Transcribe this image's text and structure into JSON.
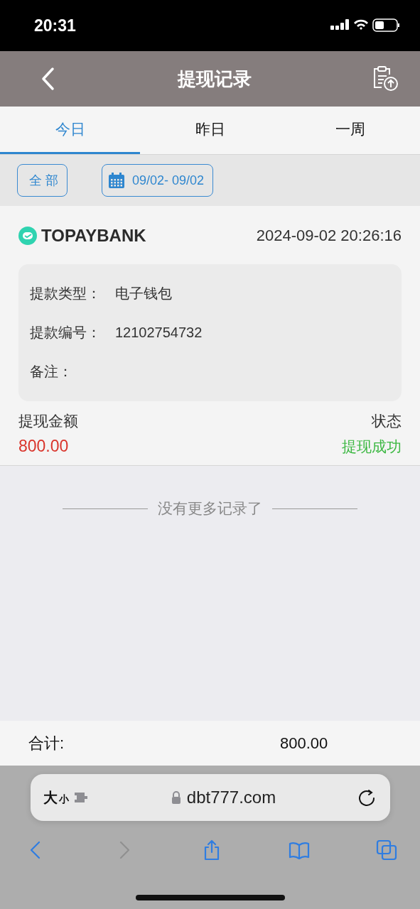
{
  "status_bar": {
    "time": "20:31"
  },
  "header": {
    "title": "提现记录"
  },
  "tabs": [
    {
      "label": "今日",
      "selected": true
    },
    {
      "label": "昨日",
      "selected": false
    },
    {
      "label": "一周",
      "selected": false
    }
  ],
  "filters": {
    "all_button": "全 部",
    "date_range": "09/02- 09/02"
  },
  "records": [
    {
      "bank": "TOPAYBANK",
      "time": "2024-09-02 20:26:16",
      "details": [
        {
          "label": "提款类型：",
          "value": "电子钱包"
        },
        {
          "label": "提款编号：",
          "value": "12102754732"
        },
        {
          "label": "备注："
        }
      ],
      "amount_label": "提现金额",
      "amount": "800.00",
      "status_label": "状态",
      "status": "提现成功"
    }
  ],
  "end_note": "没有更多记录了",
  "total": {
    "label": "合计:",
    "value": "800.00"
  },
  "browser": {
    "text_size": {
      "large": "大",
      "small": "小"
    },
    "url": "dbt777.com",
    "toolbar": [
      {
        "kind": "back",
        "disabled": false
      },
      {
        "kind": "forward",
        "disabled": true
      },
      {
        "kind": "share",
        "disabled": false
      },
      {
        "kind": "bookmarks",
        "disabled": false
      },
      {
        "kind": "tabs",
        "disabled": false
      }
    ]
  }
}
